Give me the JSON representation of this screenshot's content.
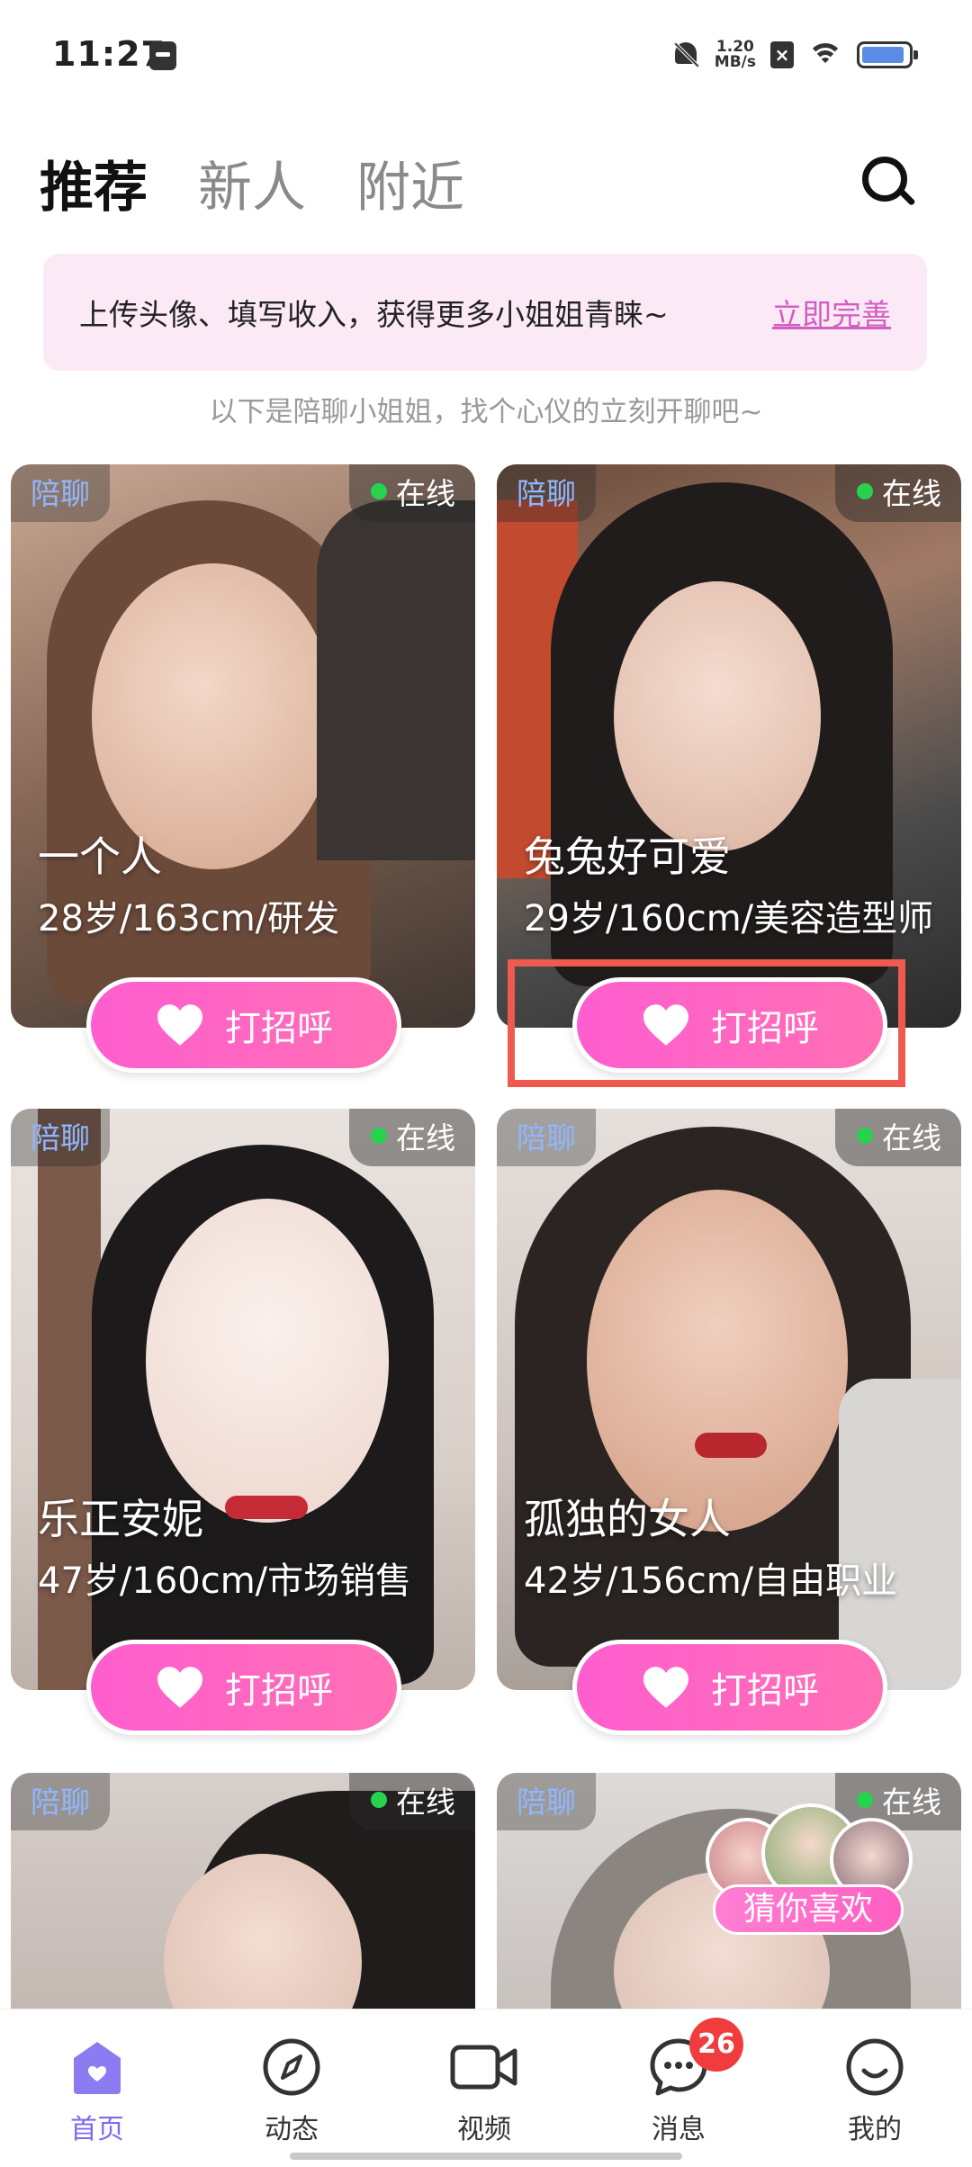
{
  "status_bar": {
    "time": "11:27",
    "net_speed_value": "1.20",
    "net_speed_unit": "MB/s",
    "icons": [
      "mute-icon",
      "wifi-icon",
      "battery-icon"
    ]
  },
  "tabs": [
    {
      "label": "推荐",
      "active": true
    },
    {
      "label": "新人",
      "active": false
    },
    {
      "label": "附近",
      "active": false
    }
  ],
  "banner": {
    "text": "上传头像、填写收入，获得更多小姐姐青睐~",
    "link": "立即完善"
  },
  "hint": "以下是陪聊小姐姐，找个心仪的立刻开聊吧~",
  "cards": [
    {
      "tag": "陪聊",
      "status": "在线",
      "name": "一个人",
      "info": "28岁/163cm/研发",
      "greet": "打招呼"
    },
    {
      "tag": "陪聊",
      "status": "在线",
      "name": "兔兔好可爱",
      "info": "29岁/160cm/美容造型师",
      "greet": "打招呼"
    },
    {
      "tag": "陪聊",
      "status": "在线",
      "name": "乐正安妮",
      "info": "47岁/160cm/市场销售",
      "greet": "打招呼"
    },
    {
      "tag": "陪聊",
      "status": "在线",
      "name": "孤独的女人",
      "info": "42岁/156cm/自由职业",
      "greet": "打招呼"
    },
    {
      "tag": "陪聊",
      "status": "在线"
    },
    {
      "tag": "陪聊",
      "status": "在线"
    }
  ],
  "guess_you_like": "猜你喜欢",
  "bottom_nav": [
    {
      "label": "首页",
      "icon": "home-icon",
      "active": true
    },
    {
      "label": "动态",
      "icon": "compass-icon",
      "active": false
    },
    {
      "label": "视频",
      "icon": "video-icon",
      "active": false
    },
    {
      "label": "消息",
      "icon": "chat-icon",
      "active": false,
      "badge": "26"
    },
    {
      "label": "我的",
      "icon": "smile-icon",
      "active": false
    }
  ],
  "colors": {
    "accent_pink": "#ff5ecf",
    "nav_active": "#7a6cf0",
    "online_dot": "#27d24f",
    "highlight": "#ef5a4e"
  }
}
